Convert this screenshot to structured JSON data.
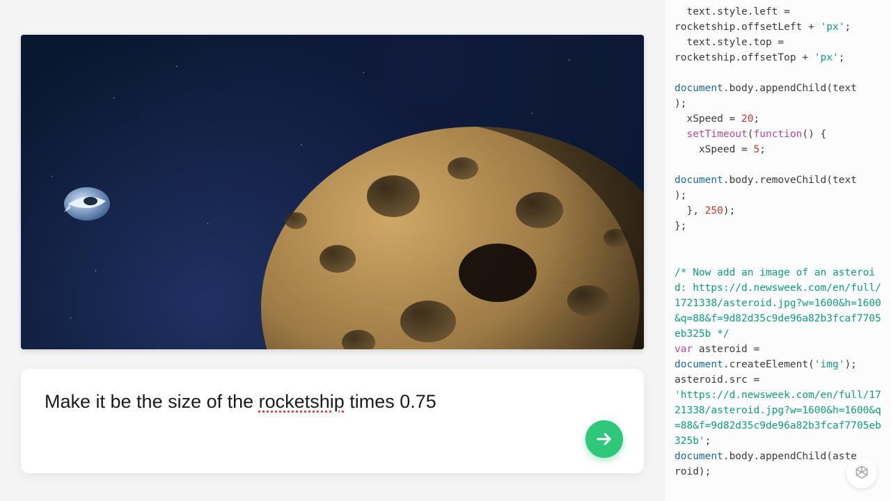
{
  "prompt": {
    "prefix": "Make it be the size of the ",
    "underlined": "rocketship",
    "suffix": " times 0.75"
  },
  "preview": {
    "rocketship_label": "rocketship",
    "asteroid_label": "asteroid"
  },
  "code": {
    "l01a": "  text.style.left =",
    "l01b": "rocketship.offsetLeft + ",
    "l01c": "'px'",
    "l01d": ";",
    "l02a": "  text.style.top =",
    "l02b": "rocketship.offsetTop + ",
    "l02c": "'px'",
    "l02d": ";",
    "l04a": "document",
    "l04b": ".body.appendChild(text",
    "l05": ");",
    "l06a": "  xSpeed = ",
    "l06b": "20",
    "l06c": ";",
    "l07a": "  ",
    "l07b": "setTimeout",
    "l07c": "(",
    "l07d": "function",
    "l07e": "() {",
    "l08a": "    xSpeed = ",
    "l08b": "5",
    "l08c": ";",
    "l10a": "document",
    "l10b": ".body.removeChild(text",
    "l11": ");",
    "l12a": "  }, ",
    "l12b": "250",
    "l12c": ");",
    "l13": "};",
    "c1": "/* Now add an image of an asteroid: https://d.newsweek.com/en/full/1721338/asteroid.jpg?w=1600&h=1600&q=88&f=9d82d35c9de96a82b3fcaf7705eb325b */",
    "l20a": "var",
    "l20b": " asteroid =",
    "l21a": "document",
    "l21b": ".createElement(",
    "l21c": "'img'",
    "l21d": ");",
    "l22": "asteroid.src =",
    "l23": "'https://d.newsweek.com/en/full/1721338/asteroid.jpg?w=1600&h=1600&q=88&f=9d82d35c9de96a82b3fcaf7705eb325b'",
    "l23b": ";",
    "l24a": "document",
    "l24b": ".body.appendChild(aste",
    "l25": "roid);"
  }
}
